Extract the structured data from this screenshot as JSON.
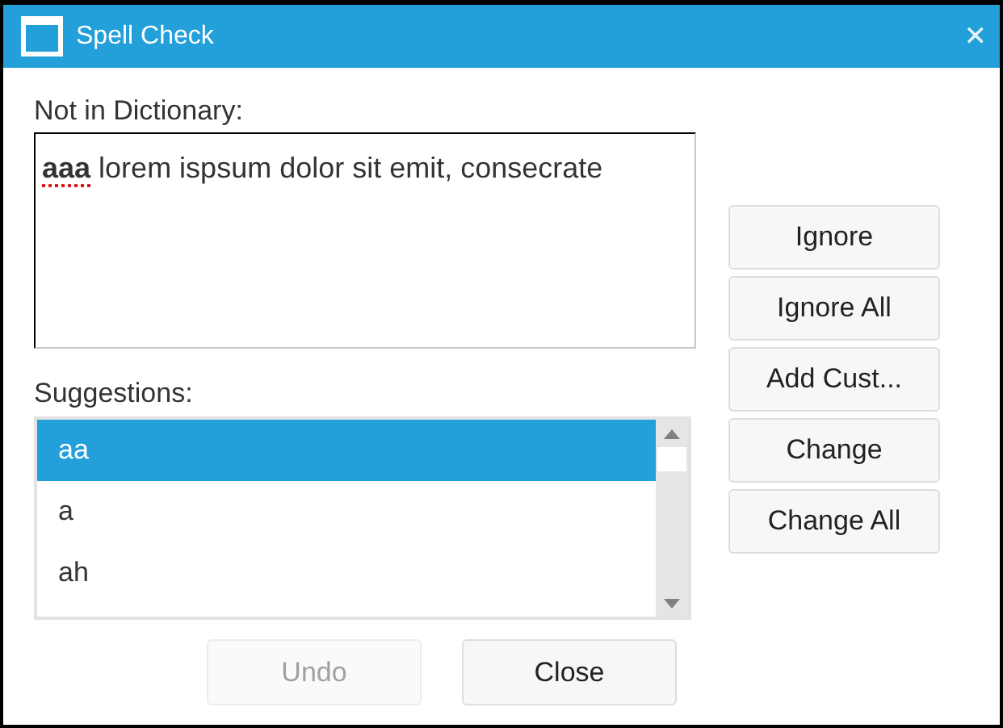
{
  "window": {
    "title": "Spell Check",
    "close": "✕"
  },
  "not_in_dictionary": {
    "label": "Not in Dictionary:",
    "text": "**aaa** lorem ispsum dolor sit emit, consecrate"
  },
  "suggestions": {
    "label": "Suggestions:",
    "items": [
      {
        "text": "aa",
        "selected": true
      },
      {
        "text": "a",
        "selected": false
      },
      {
        "text": "ah",
        "selected": false
      }
    ]
  },
  "side_buttons": [
    {
      "label": "Ignore",
      "disabled": false
    },
    {
      "label": "Ignore All",
      "disabled": false
    },
    {
      "label": "Add Cust...",
      "disabled": false
    },
    {
      "label": "Change",
      "disabled": false
    },
    {
      "label": "Change All",
      "disabled": false
    }
  ],
  "bottom_buttons": [
    {
      "label": "Undo",
      "disabled": true
    },
    {
      "label": "Close",
      "disabled": false
    }
  ]
}
